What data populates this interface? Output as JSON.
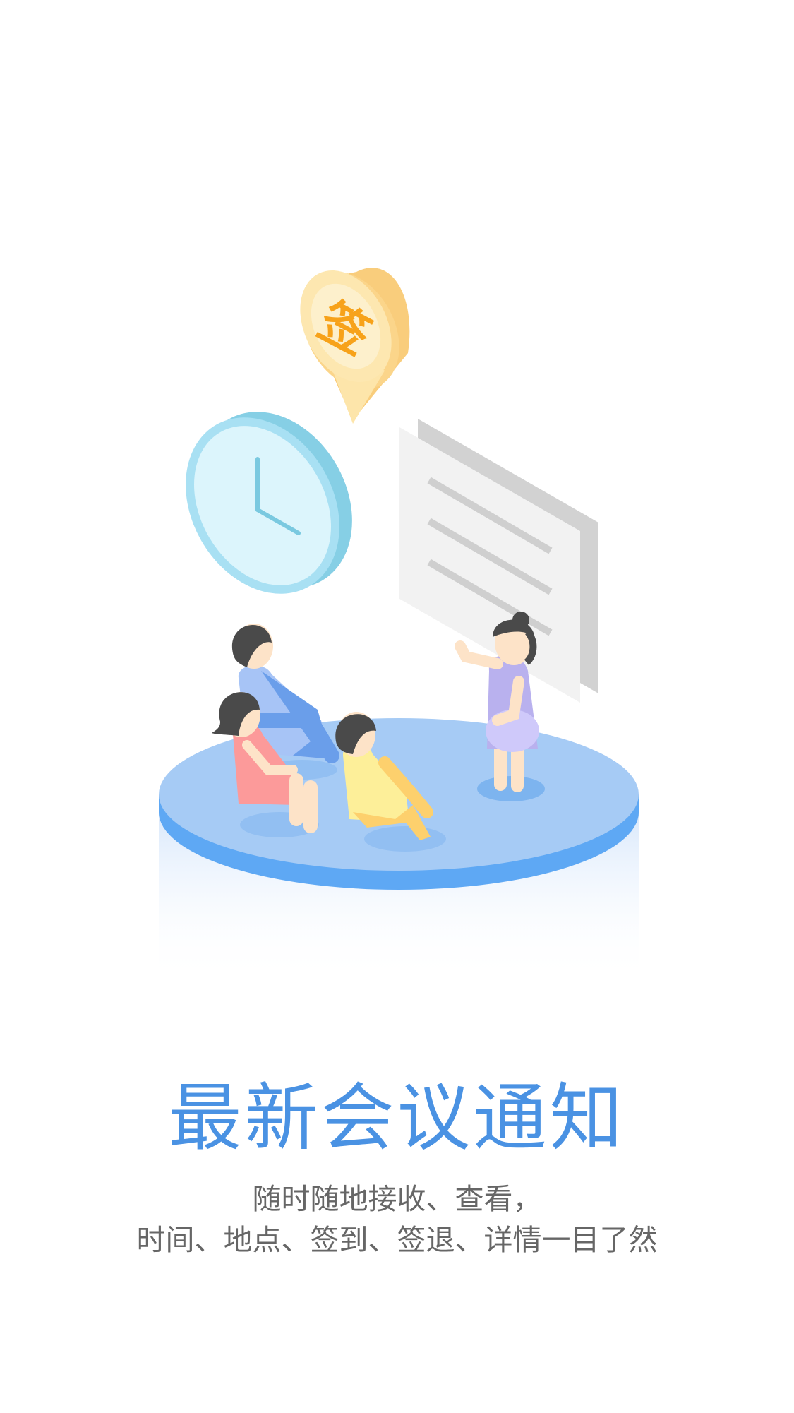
{
  "onboarding": {
    "title": "最新会议通知",
    "subtitle_line1": "随时随地接收、查看，",
    "subtitle_line2": "时间、地点、签到、签退、详情一目了然"
  },
  "illustration": {
    "pin_glyph": "签",
    "icons": [
      "location-pin-icon",
      "clock-icon",
      "document-icon"
    ]
  },
  "colors": {
    "title": "#4a92e3",
    "subtitle": "#666666",
    "platform": "#a6cbf5",
    "platform_edge": "#5ea8f4"
  }
}
